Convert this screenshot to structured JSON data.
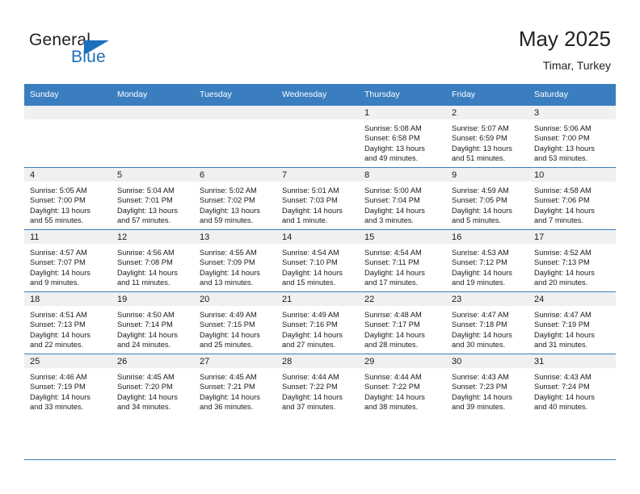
{
  "brand": {
    "word_one": "General",
    "word_two": "Blue",
    "triangle_icon": "triangle-logo-icon",
    "accent_color": "#1c6fba"
  },
  "header": {
    "title": "May 2025",
    "subtitle": "Timar, Turkey"
  },
  "colors": {
    "header_row_bg": "#3b7ebf",
    "header_row_text": "#ffffff",
    "daynum_bg": "#f0f0f0",
    "cell_text": "#1a1a1a",
    "grid_line": "#3b7ebf"
  },
  "weekday_headers": [
    "Sunday",
    "Monday",
    "Tuesday",
    "Wednesday",
    "Thursday",
    "Friday",
    "Saturday"
  ],
  "weeks": [
    [
      {
        "day": "",
        "sunrise": "",
        "sunset": "",
        "daylight_line1": "",
        "daylight_line2": "",
        "empty": true
      },
      {
        "day": "",
        "sunrise": "",
        "sunset": "",
        "daylight_line1": "",
        "daylight_line2": "",
        "empty": true
      },
      {
        "day": "",
        "sunrise": "",
        "sunset": "",
        "daylight_line1": "",
        "daylight_line2": "",
        "empty": true
      },
      {
        "day": "",
        "sunrise": "",
        "sunset": "",
        "daylight_line1": "",
        "daylight_line2": "",
        "empty": true
      },
      {
        "day": "1",
        "sunrise": "Sunrise: 5:08 AM",
        "sunset": "Sunset: 6:58 PM",
        "daylight_line1": "Daylight: 13 hours",
        "daylight_line2": "and 49 minutes."
      },
      {
        "day": "2",
        "sunrise": "Sunrise: 5:07 AM",
        "sunset": "Sunset: 6:59 PM",
        "daylight_line1": "Daylight: 13 hours",
        "daylight_line2": "and 51 minutes."
      },
      {
        "day": "3",
        "sunrise": "Sunrise: 5:06 AM",
        "sunset": "Sunset: 7:00 PM",
        "daylight_line1": "Daylight: 13 hours",
        "daylight_line2": "and 53 minutes."
      }
    ],
    [
      {
        "day": "4",
        "sunrise": "Sunrise: 5:05 AM",
        "sunset": "Sunset: 7:00 PM",
        "daylight_line1": "Daylight: 13 hours",
        "daylight_line2": "and 55 minutes."
      },
      {
        "day": "5",
        "sunrise": "Sunrise: 5:04 AM",
        "sunset": "Sunset: 7:01 PM",
        "daylight_line1": "Daylight: 13 hours",
        "daylight_line2": "and 57 minutes."
      },
      {
        "day": "6",
        "sunrise": "Sunrise: 5:02 AM",
        "sunset": "Sunset: 7:02 PM",
        "daylight_line1": "Daylight: 13 hours",
        "daylight_line2": "and 59 minutes."
      },
      {
        "day": "7",
        "sunrise": "Sunrise: 5:01 AM",
        "sunset": "Sunset: 7:03 PM",
        "daylight_line1": "Daylight: 14 hours",
        "daylight_line2": "and 1 minute."
      },
      {
        "day": "8",
        "sunrise": "Sunrise: 5:00 AM",
        "sunset": "Sunset: 7:04 PM",
        "daylight_line1": "Daylight: 14 hours",
        "daylight_line2": "and 3 minutes."
      },
      {
        "day": "9",
        "sunrise": "Sunrise: 4:59 AM",
        "sunset": "Sunset: 7:05 PM",
        "daylight_line1": "Daylight: 14 hours",
        "daylight_line2": "and 5 minutes."
      },
      {
        "day": "10",
        "sunrise": "Sunrise: 4:58 AM",
        "sunset": "Sunset: 7:06 PM",
        "daylight_line1": "Daylight: 14 hours",
        "daylight_line2": "and 7 minutes."
      }
    ],
    [
      {
        "day": "11",
        "sunrise": "Sunrise: 4:57 AM",
        "sunset": "Sunset: 7:07 PM",
        "daylight_line1": "Daylight: 14 hours",
        "daylight_line2": "and 9 minutes."
      },
      {
        "day": "12",
        "sunrise": "Sunrise: 4:56 AM",
        "sunset": "Sunset: 7:08 PM",
        "daylight_line1": "Daylight: 14 hours",
        "daylight_line2": "and 11 minutes."
      },
      {
        "day": "13",
        "sunrise": "Sunrise: 4:55 AM",
        "sunset": "Sunset: 7:09 PM",
        "daylight_line1": "Daylight: 14 hours",
        "daylight_line2": "and 13 minutes."
      },
      {
        "day": "14",
        "sunrise": "Sunrise: 4:54 AM",
        "sunset": "Sunset: 7:10 PM",
        "daylight_line1": "Daylight: 14 hours",
        "daylight_line2": "and 15 minutes."
      },
      {
        "day": "15",
        "sunrise": "Sunrise: 4:54 AM",
        "sunset": "Sunset: 7:11 PM",
        "daylight_line1": "Daylight: 14 hours",
        "daylight_line2": "and 17 minutes."
      },
      {
        "day": "16",
        "sunrise": "Sunrise: 4:53 AM",
        "sunset": "Sunset: 7:12 PM",
        "daylight_line1": "Daylight: 14 hours",
        "daylight_line2": "and 19 minutes."
      },
      {
        "day": "17",
        "sunrise": "Sunrise: 4:52 AM",
        "sunset": "Sunset: 7:13 PM",
        "daylight_line1": "Daylight: 14 hours",
        "daylight_line2": "and 20 minutes."
      }
    ],
    [
      {
        "day": "18",
        "sunrise": "Sunrise: 4:51 AM",
        "sunset": "Sunset: 7:13 PM",
        "daylight_line1": "Daylight: 14 hours",
        "daylight_line2": "and 22 minutes."
      },
      {
        "day": "19",
        "sunrise": "Sunrise: 4:50 AM",
        "sunset": "Sunset: 7:14 PM",
        "daylight_line1": "Daylight: 14 hours",
        "daylight_line2": "and 24 minutes."
      },
      {
        "day": "20",
        "sunrise": "Sunrise: 4:49 AM",
        "sunset": "Sunset: 7:15 PM",
        "daylight_line1": "Daylight: 14 hours",
        "daylight_line2": "and 25 minutes."
      },
      {
        "day": "21",
        "sunrise": "Sunrise: 4:49 AM",
        "sunset": "Sunset: 7:16 PM",
        "daylight_line1": "Daylight: 14 hours",
        "daylight_line2": "and 27 minutes."
      },
      {
        "day": "22",
        "sunrise": "Sunrise: 4:48 AM",
        "sunset": "Sunset: 7:17 PM",
        "daylight_line1": "Daylight: 14 hours",
        "daylight_line2": "and 28 minutes."
      },
      {
        "day": "23",
        "sunrise": "Sunrise: 4:47 AM",
        "sunset": "Sunset: 7:18 PM",
        "daylight_line1": "Daylight: 14 hours",
        "daylight_line2": "and 30 minutes."
      },
      {
        "day": "24",
        "sunrise": "Sunrise: 4:47 AM",
        "sunset": "Sunset: 7:19 PM",
        "daylight_line1": "Daylight: 14 hours",
        "daylight_line2": "and 31 minutes."
      }
    ],
    [
      {
        "day": "25",
        "sunrise": "Sunrise: 4:46 AM",
        "sunset": "Sunset: 7:19 PM",
        "daylight_line1": "Daylight: 14 hours",
        "daylight_line2": "and 33 minutes."
      },
      {
        "day": "26",
        "sunrise": "Sunrise: 4:45 AM",
        "sunset": "Sunset: 7:20 PM",
        "daylight_line1": "Daylight: 14 hours",
        "daylight_line2": "and 34 minutes."
      },
      {
        "day": "27",
        "sunrise": "Sunrise: 4:45 AM",
        "sunset": "Sunset: 7:21 PM",
        "daylight_line1": "Daylight: 14 hours",
        "daylight_line2": "and 36 minutes."
      },
      {
        "day": "28",
        "sunrise": "Sunrise: 4:44 AM",
        "sunset": "Sunset: 7:22 PM",
        "daylight_line1": "Daylight: 14 hours",
        "daylight_line2": "and 37 minutes."
      },
      {
        "day": "29",
        "sunrise": "Sunrise: 4:44 AM",
        "sunset": "Sunset: 7:22 PM",
        "daylight_line1": "Daylight: 14 hours",
        "daylight_line2": "and 38 minutes."
      },
      {
        "day": "30",
        "sunrise": "Sunrise: 4:43 AM",
        "sunset": "Sunset: 7:23 PM",
        "daylight_line1": "Daylight: 14 hours",
        "daylight_line2": "and 39 minutes."
      },
      {
        "day": "31",
        "sunrise": "Sunrise: 4:43 AM",
        "sunset": "Sunset: 7:24 PM",
        "daylight_line1": "Daylight: 14 hours",
        "daylight_line2": "and 40 minutes."
      }
    ]
  ]
}
